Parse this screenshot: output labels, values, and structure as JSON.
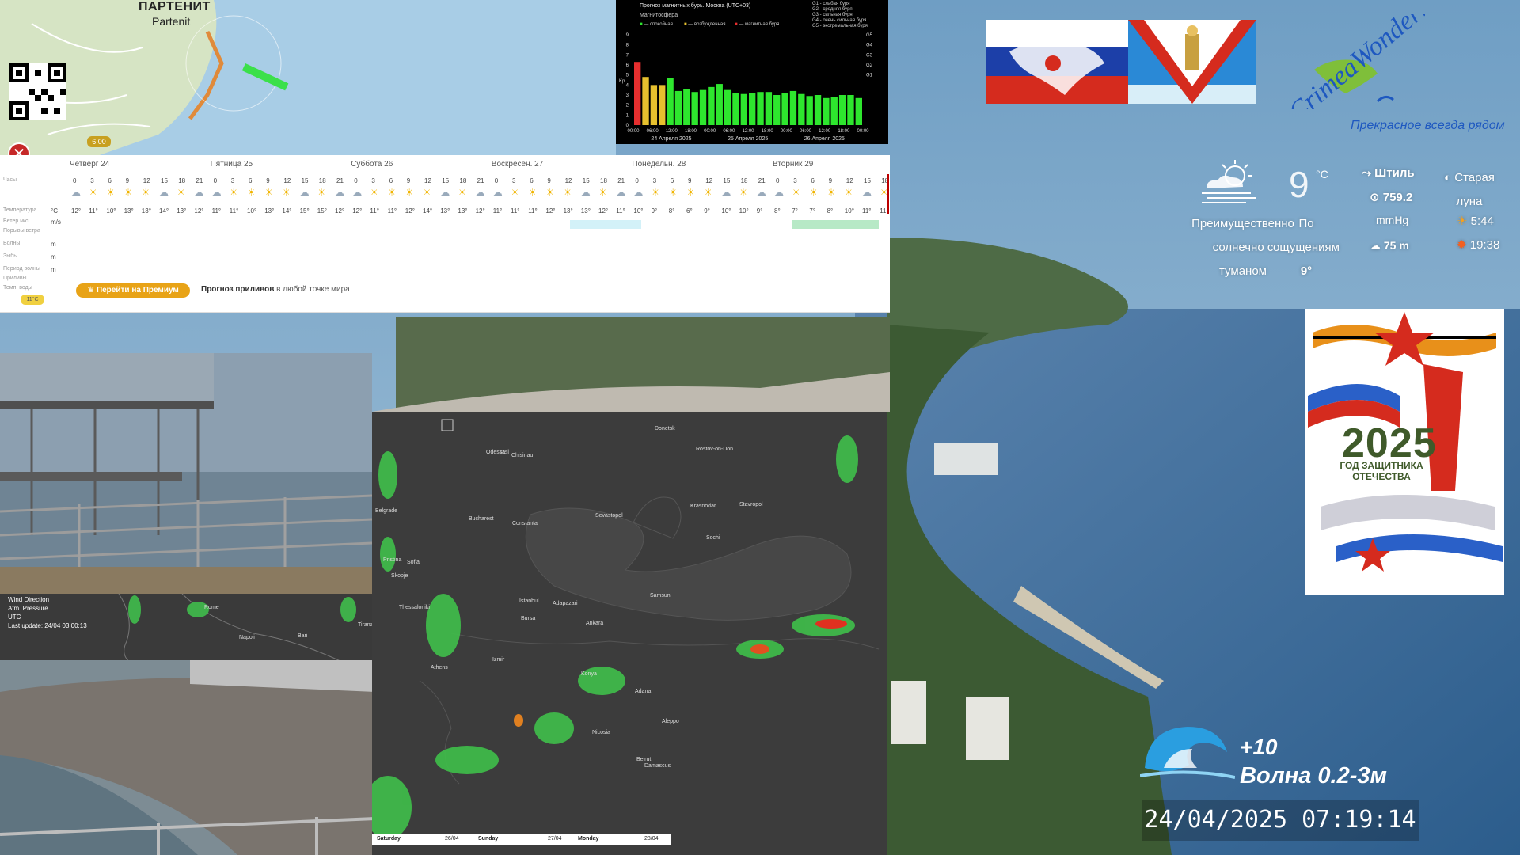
{
  "map": {
    "place_ru": "ПАРТЕНИТ",
    "place_en": "Partenit",
    "time_chip": "6:00"
  },
  "magnetic": {
    "title": "Прогноз магнитных бурь. Москва (UTC+03)",
    "subtitle": "Магнитосфера",
    "legend_left": [
      "— спокойная",
      "— возбужденная",
      "— магнитная буря"
    ],
    "legend_right": [
      "G1 - слабая буря",
      "G2 - средняя буря",
      "G3 - сильная буря",
      "G4 - очень сильная буря",
      "G5 - экстремальная буря"
    ],
    "axis_label": "Kp",
    "y_ticks": [
      "9",
      "8",
      "7",
      "6",
      "5",
      "4",
      "3",
      "2",
      "1",
      "0"
    ],
    "g_levels": [
      "G5",
      "G4",
      "G3",
      "G2",
      "G1"
    ],
    "x_ticks": [
      "00:00",
      "06:00",
      "12:00",
      "18:00",
      "00:00",
      "06:00",
      "12:00",
      "18:00",
      "00:00",
      "06:00",
      "12:00",
      "18:00",
      "00:00"
    ],
    "dates": [
      "24 Апреля 2025",
      "25 Апреля 2025",
      "26 Апреля 2025"
    ],
    "values": [
      6.3,
      4.8,
      4.0,
      4.0,
      4.7,
      3.4,
      3.6,
      3.3,
      3.5,
      3.8,
      4.1,
      3.5,
      3.2,
      3.1,
      3.2,
      3.3,
      3.3,
      3.0,
      3.2,
      3.4,
      3.1,
      2.9,
      3.0,
      2.7,
      2.8,
      3.0,
      3.0,
      2.7
    ]
  },
  "forecast": {
    "days": [
      "Четверг 24",
      "Пятница 25",
      "Суббота 26",
      "Воскресен. 27",
      "Понедельн. 28",
      "Вторник 29"
    ],
    "row_labels": [
      "Часы",
      "Температура",
      "Ветер м/с",
      "Порывы ветра",
      "Волны",
      "Зыбь",
      "Период волны",
      "Приливы",
      "Темп. воды"
    ],
    "units": [
      "°C",
      "m/s",
      "m",
      "m",
      "m"
    ],
    "hours": [
      "0",
      "3",
      "6",
      "9",
      "12",
      "15",
      "18",
      "21"
    ],
    "temps": [
      "12°",
      "11°",
      "10°",
      "13°",
      "13°",
      "14°",
      "13°",
      "12°",
      "11°",
      "11°",
      "10°",
      "13°",
      "14°",
      "15°",
      "15°",
      "12°",
      "12°",
      "11°",
      "11°",
      "12°",
      "14°",
      "13°",
      "13°",
      "12°",
      "11°",
      "11°",
      "11°",
      "12°",
      "13°",
      "13°",
      "12°",
      "11°",
      "10°",
      "9°",
      "8°",
      "6°",
      "9°",
      "10°",
      "10°",
      "9°",
      "8°",
      "7°",
      "7°",
      "8°",
      "10°",
      "11°",
      "11°",
      "10°"
    ],
    "premium_button": "Перейти на Премиум",
    "tides_bold": "Прогноз приливов",
    "tides_rest": " в любой точке мира",
    "water_temp": "11°C"
  },
  "brand": {
    "name": "CrimeaWonderland",
    "tagline": "Прекрасное всегда рядом"
  },
  "weather": {
    "temp": "9",
    "unit": "°C",
    "condition_lines": [
      "Преимущественно",
      "солнечно с",
      "туманом"
    ],
    "feels_lines": [
      "По",
      "ощущениям"
    ],
    "feels_value": "9°",
    "wind": "Штиль",
    "pressure": "759.2",
    "pressure_unit": "mmHg",
    "visibility": "75 m",
    "moon_lines": [
      "Старая",
      "луна"
    ],
    "sunrise": "5:44",
    "sunset": "19:38"
  },
  "poster": {
    "year": "2025",
    "caption": "ГОД ЗАЩИТНИКА ОТЕЧЕСТВА"
  },
  "strip": {
    "legend": [
      "Wind Direction",
      "Atm. Pressure",
      "UTC",
      "Last update: 24/04 03:00:13"
    ],
    "cities": [
      "Rome",
      "Napoli",
      "Bari",
      "Tirana"
    ]
  },
  "wmap": {
    "cities": [
      "Chisinau",
      "Odessa",
      "Donetsk",
      "Rostov-on-Don",
      "Iasi",
      "Sevastopol",
      "Krasnodar",
      "Stavropol",
      "Bucharest",
      "Constanta",
      "Sochi",
      "Belgrade",
      "Sofia",
      "Skopje",
      "Thessaloniki",
      "Istanbul",
      "Samsun",
      "Adapazari",
      "Bursa",
      "Ankara",
      "Izmir",
      "Athens",
      "Konya",
      "Adana",
      "Aleppo",
      "Nicosia",
      "Beirut",
      "Damascus",
      "Pristina"
    ],
    "timeline": [
      "Saturday",
      "26/04",
      "Sunday",
      "27/04",
      "Monday",
      "28/04"
    ]
  },
  "overlay": {
    "wave_plus": "+10",
    "wave_text": "Волна 0.2-3м",
    "datetime": "24/04/2025 07:19:14"
  }
}
